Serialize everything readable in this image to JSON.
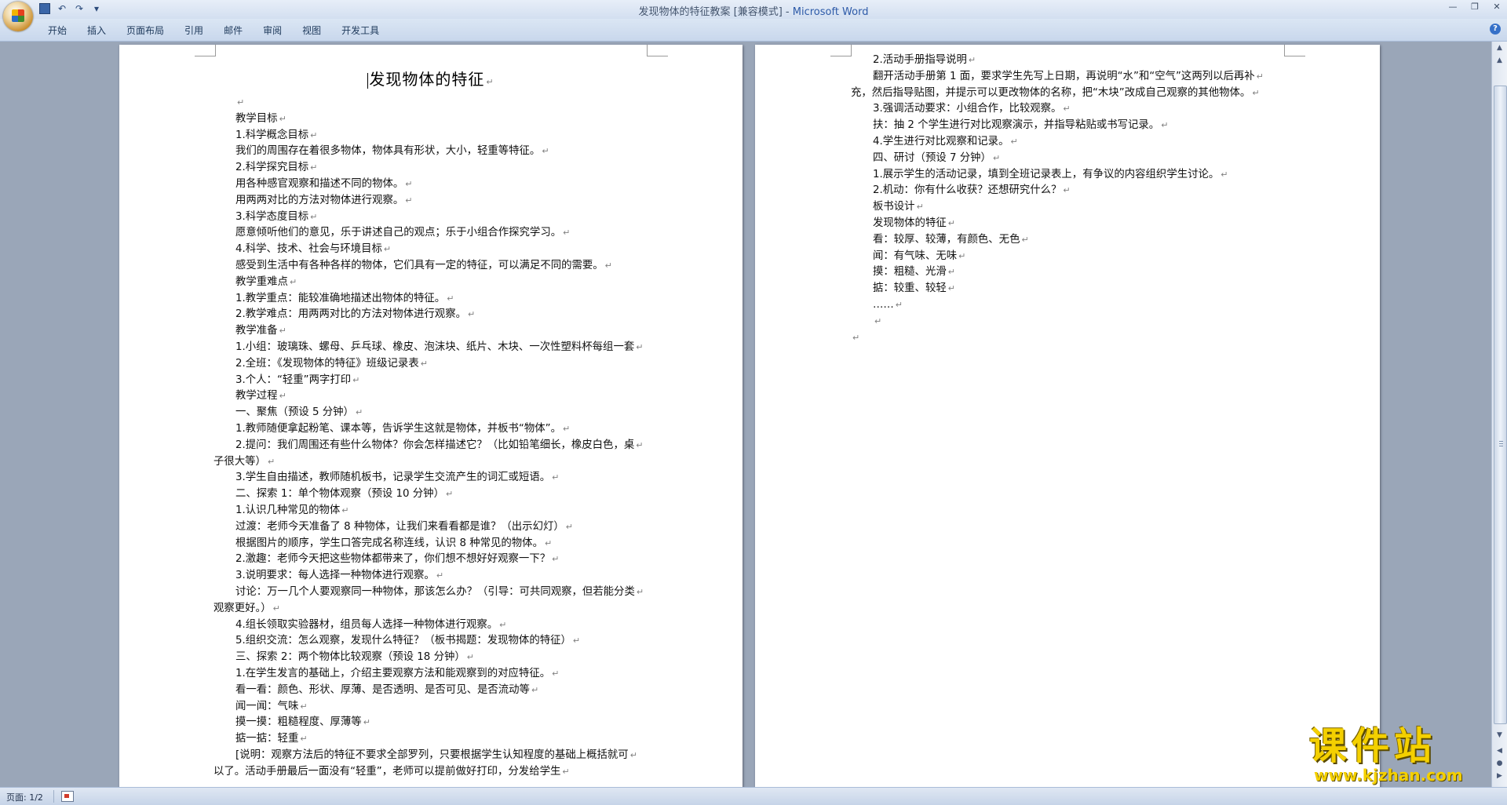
{
  "window": {
    "title_doc": "发现物体的特征教案 [兼容模式] - ",
    "title_app": "Microsoft Word",
    "min_glyph": "—",
    "max_glyph": "❐",
    "close_glyph": "✕"
  },
  "qat": {
    "undo_glyph": "↶",
    "redo_glyph": "↷",
    "more_glyph": "▾"
  },
  "ribbon": {
    "tabs": [
      "开始",
      "插入",
      "页面布局",
      "引用",
      "邮件",
      "审阅",
      "视图",
      "开发工具"
    ],
    "help_glyph": "?"
  },
  "page1": {
    "title": "发现物体的特征",
    "lines": [
      {
        "text": "",
        "indent": 2
      },
      {
        "text": "教学目标",
        "indent": 2
      },
      {
        "text": "1.科学概念目标",
        "indent": 2
      },
      {
        "text": "我们的周围存在着很多物体，物体具有形状，大小，轻重等特征。",
        "indent": 2
      },
      {
        "text": "2.科学探究目标",
        "indent": 2
      },
      {
        "text": "用各种感官观察和描述不同的物体。",
        "indent": 2
      },
      {
        "text": "用两两对比的方法对物体进行观察。",
        "indent": 2
      },
      {
        "text": "3.科学态度目标",
        "indent": 2
      },
      {
        "text": "愿意倾听他们的意见，乐于讲述自己的观点；乐于小组合作探究学习。",
        "indent": 2
      },
      {
        "text": "4.科学、技术、社会与环境目标",
        "indent": 2
      },
      {
        "text": "感受到生活中有各种各样的物体，它们具有一定的特征，可以满足不同的需要。",
        "indent": 2
      },
      {
        "text": "教学重难点",
        "indent": 2
      },
      {
        "text": "1.教学重点：能较准确地描述出物体的特征。",
        "indent": 2
      },
      {
        "text": "2.教学难点：用两两对比的方法对物体进行观察。",
        "indent": 2
      },
      {
        "text": "教学准备",
        "indent": 2
      },
      {
        "text": "1.小组：玻璃珠、螺母、乒乓球、橡皮、泡沫块、纸片、木块、一次性塑料杯每组一套",
        "indent": 2
      },
      {
        "text": "2.全班：《发现物体的特征》班级记录表",
        "indent": 2
      },
      {
        "text": "3.个人：“轻重”两字打印",
        "indent": 2
      },
      {
        "text": "教学过程",
        "indent": 2
      },
      {
        "text": "一、聚焦（预设 5 分钟）",
        "indent": 2
      },
      {
        "text": "1.教师随便拿起粉笔、课本等，告诉学生这就是物体，并板书“物体”。",
        "indent": 2
      },
      {
        "text": "2.提问：我们周围还有些什么物体？你会怎样描述它？（比如铅笔细长，橡皮白色，桌",
        "indent": 2
      },
      {
        "text": "子很大等）",
        "indent": 0
      },
      {
        "text": "3.学生自由描述，教师随机板书，记录学生交流产生的词汇或短语。",
        "indent": 2
      },
      {
        "text": "二、探索 1：单个物体观察（预设 10 分钟）",
        "indent": 2
      },
      {
        "text": "1.认识几种常见的物体",
        "indent": 2
      },
      {
        "text": "过渡：老师今天准备了 8 种物体，让我们来看看都是谁？（出示幻灯）",
        "indent": 2
      },
      {
        "text": "根据图片的顺序，学生口答完成名称连线，认识 8 种常见的物体。",
        "indent": 2
      },
      {
        "text": "2.激趣：老师今天把这些物体都带来了，你们想不想好好观察一下？",
        "indent": 2
      },
      {
        "text": "3.说明要求：每人选择一种物体进行观察。",
        "indent": 2
      },
      {
        "text": "讨论：万一几个人要观察同一种物体，那该怎么办？（引导：可共同观察，但若能分类",
        "indent": 2
      },
      {
        "text": "观察更好。）",
        "indent": 0
      },
      {
        "text": "4.组长领取实验器材，组员每人选择一种物体进行观察。",
        "indent": 2
      },
      {
        "text": "5.组织交流：怎么观察，发现什么特征？（板书揭题：发现物体的特征）",
        "indent": 2
      },
      {
        "text": "三、探索 2：两个物体比较观察（预设 18 分钟）",
        "indent": 2
      },
      {
        "text": "1.在学生发言的基础上，介绍主要观察方法和能观察到的对应特征。",
        "indent": 2
      },
      {
        "text": "看一看：颜色、形状、厚薄、是否透明、是否可见、是否流动等",
        "indent": 2
      },
      {
        "text": "闻一闻：气味",
        "indent": 2
      },
      {
        "text": "摸一摸：粗糙程度、厚薄等",
        "indent": 2
      },
      {
        "text": "掂一掂：轻重",
        "indent": 2
      },
      {
        "text": "[说明：观察方法后的特征不要求全部罗列，只要根据学生认知程度的基础上概括就可",
        "indent": 2
      },
      {
        "text": "以了。活动手册最后一面没有“轻重”，老师可以提前做好打印，分发给学生",
        "indent": 0
      }
    ]
  },
  "page2": {
    "lines": [
      {
        "text": "2.活动手册指导说明",
        "indent": 2
      },
      {
        "text": "翻开活动手册第 1 面，要求学生先写上日期，再说明“水”和“空气”这两列以后再补",
        "indent": 2
      },
      {
        "text": "充，然后指导贴图，并提示可以更改物体的名称，把“木块”改成自己观察的其他物体。",
        "indent": 0
      },
      {
        "text": "3.强调活动要求：小组合作，比较观察。",
        "indent": 2
      },
      {
        "text": "扶：抽 2 个学生进行对比观察演示，并指导粘贴或书写记录。",
        "indent": 2
      },
      {
        "text": "4.学生进行对比观察和记录。",
        "indent": 2
      },
      {
        "text": "四、研讨（预设 7 分钟）",
        "indent": 2
      },
      {
        "text": "1.展示学生的活动记录，填到全班记录表上，有争议的内容组织学生讨论。",
        "indent": 2
      },
      {
        "text": "2.机动：你有什么收获？还想研究什么？",
        "indent": 2
      },
      {
        "text": "板书设计",
        "indent": 2
      },
      {
        "text": "发现物体的特征",
        "indent": 2
      },
      {
        "text": "看：较厚、较薄，有颜色、无色",
        "indent": 2
      },
      {
        "text": "闻：有气味、无味",
        "indent": 2
      },
      {
        "text": "摸：粗糙、光滑",
        "indent": 2
      },
      {
        "text": "掂：较重、较轻",
        "indent": 2
      },
      {
        "text": "……",
        "indent": 2
      },
      {
        "text": "",
        "indent": 2
      },
      {
        "text": "",
        "indent": 0
      }
    ]
  },
  "paragraph_mark": "↵",
  "scrollbar": {
    "up_glyph": "▲",
    "down_glyph": "▼",
    "prev_glyph": "◀",
    "next_glyph": "▶"
  },
  "status": {
    "page": "页面: 1/2"
  },
  "watermark": {
    "name": "课件站",
    "url": "www.kjzhan.com"
  },
  "colors": {
    "title_app": "#2d5aa8",
    "watermark": "#f4d000",
    "workspace_bg": "#9aa6b8"
  }
}
